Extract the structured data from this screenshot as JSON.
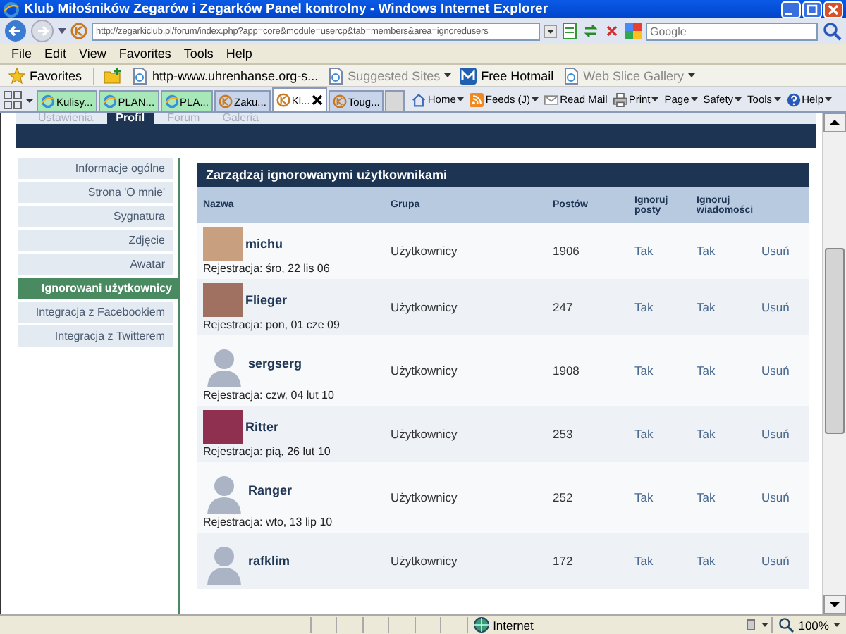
{
  "window": {
    "title": "Klub Miłośników Zegarów i Zegarków Panel kontrolny - Windows Internet Explorer"
  },
  "address_bar": {
    "url": "http://zegarkiclub.pl/forum/index.php?app=core&module=usercp&tab=members&area=ignoredusers",
    "search_placeholder": "Google"
  },
  "menu": [
    "File",
    "Edit",
    "View",
    "Favorites",
    "Tools",
    "Help"
  ],
  "favorites_bar": {
    "label": "Favorites",
    "links": [
      {
        "label": "http-www.uhrenhanse.org-s...",
        "dimmed": false,
        "dropdown": false
      },
      {
        "label": "Suggested Sites",
        "dimmed": true,
        "dropdown": true
      },
      {
        "label": "Free Hotmail",
        "dimmed": false,
        "dropdown": false
      },
      {
        "label": "Web Slice Gallery",
        "dimmed": true,
        "dropdown": true
      }
    ]
  },
  "browser_tabs": [
    {
      "label": "Kulisy...",
      "kind": "ie",
      "selected": false
    },
    {
      "label": "PLAN...",
      "kind": "ie",
      "selected": false
    },
    {
      "label": "PLA...",
      "kind": "ie",
      "selected": false
    },
    {
      "label": "Zaku...",
      "kind": "site",
      "selected": false
    },
    {
      "label": "Kl...",
      "kind": "site",
      "selected": true
    },
    {
      "label": "Toug...",
      "kind": "site",
      "selected": false
    }
  ],
  "command_bar": [
    "Home",
    "Feeds (J)",
    "Read Mail",
    "Print",
    "Page",
    "Safety",
    "Tools",
    "Help"
  ],
  "site_tabs": [
    {
      "label": "Ustawienia",
      "selected": false
    },
    {
      "label": "Profil",
      "selected": true
    },
    {
      "label": "Forum",
      "selected": false
    },
    {
      "label": "Galeria",
      "selected": false
    }
  ],
  "sidebar": {
    "items": [
      {
        "label": "Informacje ogólne",
        "selected": false
      },
      {
        "label": "Strona 'O mnie'",
        "selected": false
      },
      {
        "label": "Sygnatura",
        "selected": false
      },
      {
        "label": "Zdjęcie",
        "selected": false
      },
      {
        "label": "Awatar",
        "selected": false
      },
      {
        "label": "Ignorowani użytkownicy",
        "selected": true
      },
      {
        "label": "Integracja z Facebookiem",
        "selected": false
      },
      {
        "label": "Integracja z Twitterem",
        "selected": false
      }
    ]
  },
  "panel": {
    "title": "Zarządzaj ignorowanymi użytkownikami",
    "columns": [
      "Nazwa",
      "Grupa",
      "Postów",
      "Ignoruj posty",
      "Ignoruj wiadomości"
    ],
    "rows": [
      {
        "name": "michu",
        "kind": "photo",
        "registered": "Rejestracja: śro, 22 lis 06",
        "group": "Użytkownicy",
        "posts": "1906",
        "ignore_posts": "Tak",
        "ignore_messages": "Tak",
        "action": "Usuń"
      },
      {
        "name": "Flieger",
        "kind": "photo",
        "registered": "Rejestracja: pon, 01 cze 09",
        "group": "Użytkownicy",
        "posts": "247",
        "ignore_posts": "Tak",
        "ignore_messages": "Tak",
        "action": "Usuń"
      },
      {
        "name": "sergserg",
        "kind": "silhouette",
        "registered": "Rejestracja: czw, 04 lut 10",
        "group": "Użytkownicy",
        "posts": "1908",
        "ignore_posts": "Tak",
        "ignore_messages": "Tak",
        "action": "Usuń"
      },
      {
        "name": "Ritter",
        "kind": "photo",
        "registered": "Rejestracja: pią, 26 lut 10",
        "group": "Użytkownicy",
        "posts": "253",
        "ignore_posts": "Tak",
        "ignore_messages": "Tak",
        "action": "Usuń"
      },
      {
        "name": "Ranger",
        "kind": "silhouette",
        "registered": "Rejestracja: wto, 13 lip 10",
        "group": "Użytkownicy",
        "posts": "252",
        "ignore_posts": "Tak",
        "ignore_messages": "Tak",
        "action": "Usuń"
      },
      {
        "name": "rafklim",
        "kind": "silhouette",
        "group": "Użytkownicy",
        "posts": "172",
        "ignore_posts": "Tak",
        "ignore_messages": "Tak",
        "action": "Usuń"
      }
    ]
  },
  "status_bar": {
    "zone": "Internet",
    "zoom": "100%"
  }
}
